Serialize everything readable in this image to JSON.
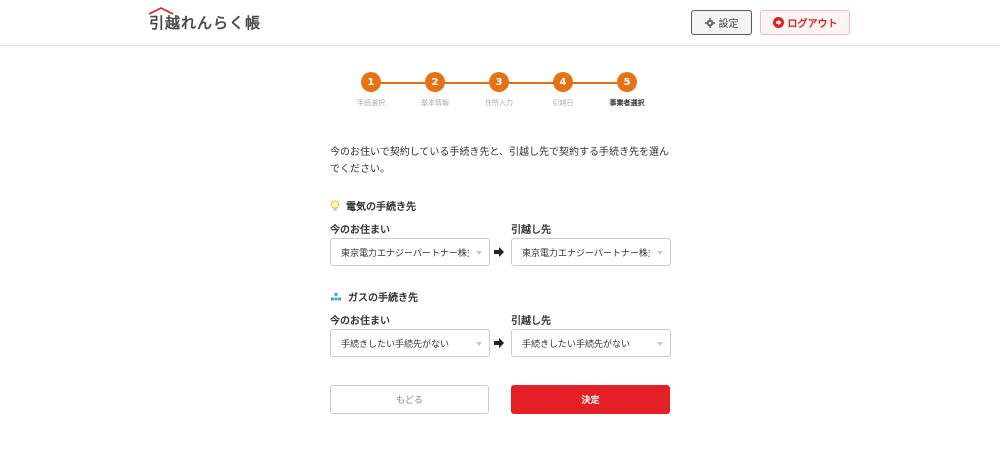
{
  "header": {
    "logo": "引越れんらく帳",
    "settings_label": "設定",
    "logout_label": "ログアウト"
  },
  "steps": [
    {
      "number": "1",
      "label": "手続選択"
    },
    {
      "number": "2",
      "label": "基本情報"
    },
    {
      "number": "3",
      "label": "住所入力"
    },
    {
      "number": "4",
      "label": "引越日"
    },
    {
      "number": "5",
      "label": "事業者選択"
    }
  ],
  "active_step": "5",
  "intro_text": "今のお住いで契約している手続き先と、引越し先で契約する手続き先を選んでください。",
  "electric": {
    "title": "電気の手続き先",
    "current_label": "今のお住まい",
    "new_label": "引越し先",
    "current_value": "東京電力エナジーパートナー株式会社",
    "new_value": "東京電力エナジーパートナー株式会社"
  },
  "gas": {
    "title": "ガスの手続き先",
    "current_label": "今のお住まい",
    "new_label": "引越し先",
    "current_value": "手続きしたい手続先がない",
    "new_value": "手続きしたい手続先がない"
  },
  "actions": {
    "back_label": "もどる",
    "decide_label": "決定"
  },
  "colors": {
    "accent_orange": "#e57314",
    "primary_red": "#e42027",
    "logout_red": "#e02020"
  }
}
